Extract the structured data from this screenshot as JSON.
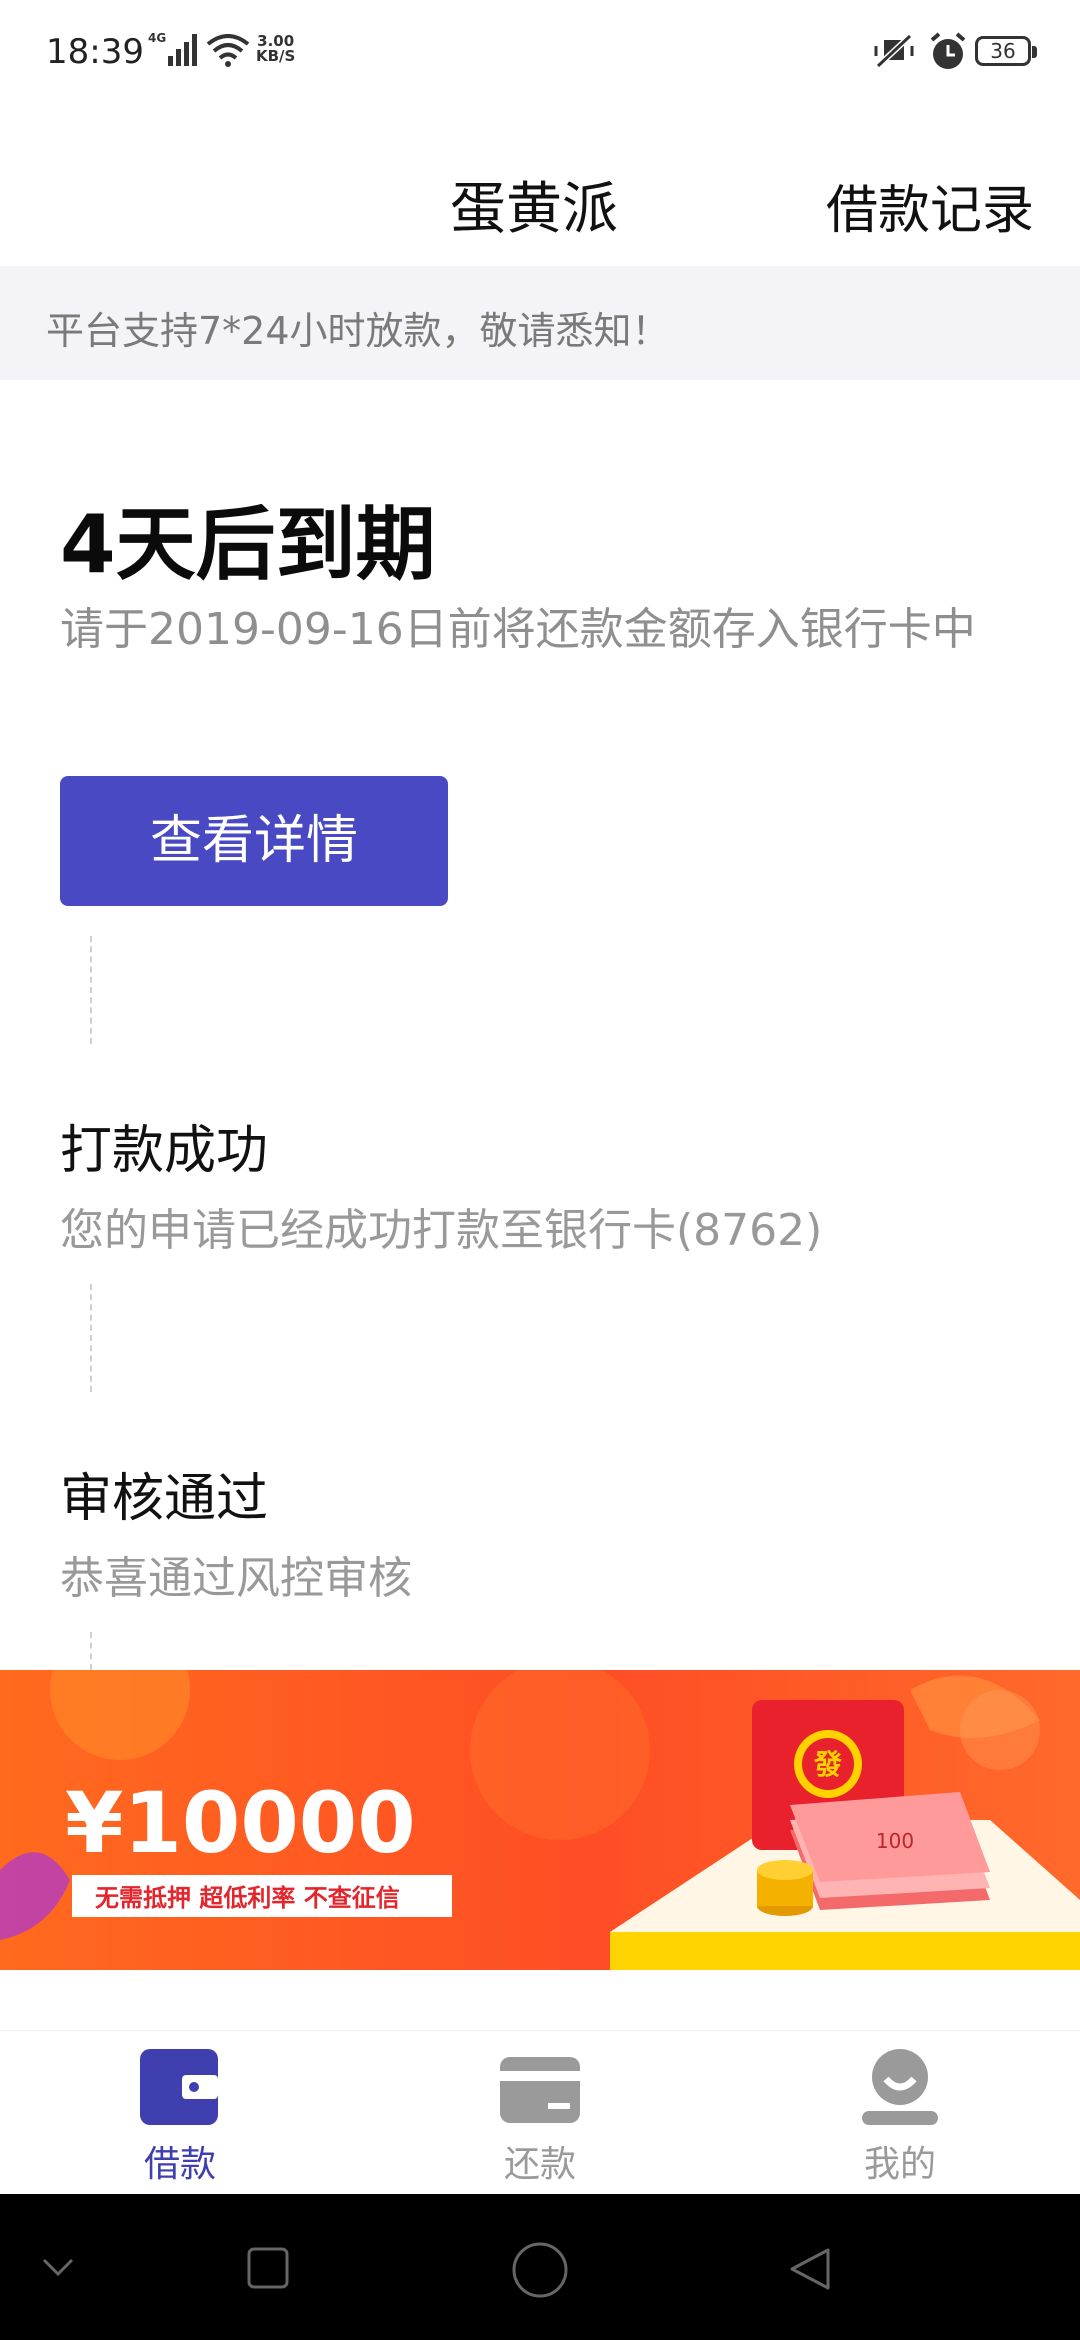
{
  "status_bar": {
    "time": "18:39",
    "network": "4G",
    "speed_value": "3.00",
    "speed_unit": "KB/S",
    "battery": "36"
  },
  "header": {
    "title": "蛋黄派",
    "right_link": "借款记录"
  },
  "notice": "平台支持7*24小时放款，敬请悉知！",
  "loan_status": {
    "title": "4天后到期",
    "description": "请于2019-09-16日前将还款金额存入银行卡中",
    "button_label": "查看详情"
  },
  "timeline": [
    {
      "title": "打款成功",
      "desc": "您的申请已经成功打款至银行卡(8762)"
    },
    {
      "title": "审核通过",
      "desc": "恭喜通过风控审核"
    }
  ],
  "banner": {
    "amount": "¥10000",
    "tagline": "无需抵押  超低利率  不查征信",
    "envelope_char": "發",
    "bill_value": "100"
  },
  "tabs": [
    {
      "label": "借款",
      "icon": "wallet-icon",
      "active": true
    },
    {
      "label": "还款",
      "icon": "card-icon",
      "active": false
    },
    {
      "label": "我的",
      "icon": "profile-icon",
      "active": false
    }
  ],
  "colors": {
    "primary": "#4a49c4",
    "notice_bg": "#f4f4f8",
    "banner_orange": "#ff5a1f"
  }
}
